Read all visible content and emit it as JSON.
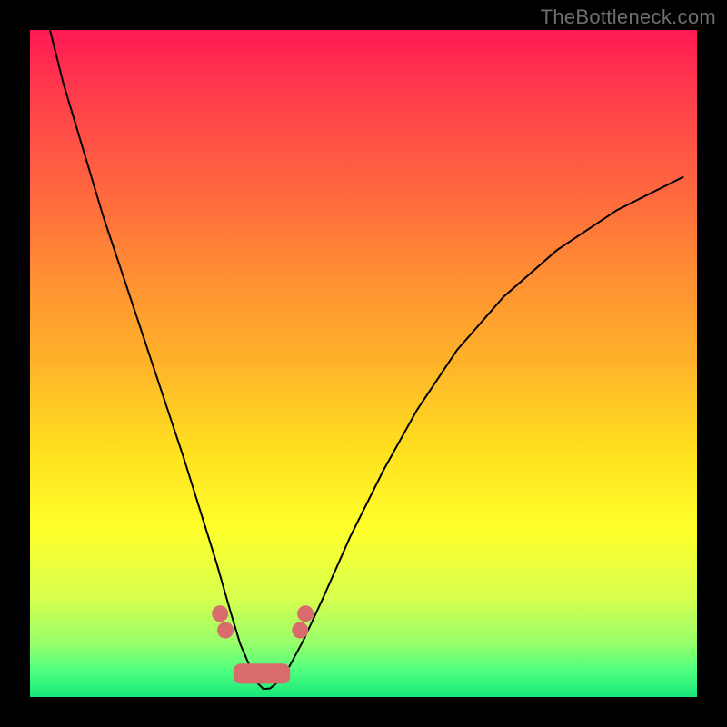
{
  "watermark": "TheBottleneck.com",
  "chart_data": {
    "type": "line",
    "title": "",
    "xlabel": "",
    "ylabel": "",
    "xlim": [
      0,
      100
    ],
    "ylim": [
      0,
      100
    ],
    "series": [
      {
        "name": "bottleneck-curve",
        "x": [
          3,
          5,
          8,
          11,
          14,
          17,
          20,
          23,
          25.5,
          28,
          30,
          31.5,
          33,
          34,
          35,
          36,
          37.5,
          39,
          41,
          44,
          48,
          53,
          58,
          64,
          71,
          79,
          88,
          98
        ],
        "values": [
          100,
          92,
          82,
          72,
          63,
          54,
          45,
          36,
          28,
          20,
          13,
          8,
          4.5,
          2.2,
          1.2,
          1.3,
          2.5,
          4.8,
          8.5,
          15,
          24,
          34,
          43,
          52,
          60,
          67,
          73,
          78
        ]
      }
    ],
    "annotations": {
      "trough_markers": {
        "dots": [
          {
            "x": 28.5,
            "y": 12.5
          },
          {
            "x": 29.3,
            "y": 10.0
          },
          {
            "x": 40.5,
            "y": 10.0
          },
          {
            "x": 41.3,
            "y": 12.5
          }
        ],
        "bar": {
          "x0": 30.5,
          "x1": 39.0,
          "y": 2.0,
          "h": 3.0
        }
      }
    }
  }
}
